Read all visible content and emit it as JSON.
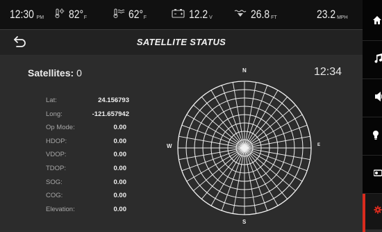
{
  "status_bar": {
    "time": {
      "value": "12:30",
      "unit": "PM",
      "icon": "clock"
    },
    "temp_1": {
      "value": "82°",
      "unit": "F",
      "icon": "thermometer-sun-icon"
    },
    "temp_2": {
      "value": "62°",
      "unit": "F",
      "icon": "thermometer-water-icon"
    },
    "voltage": {
      "value": "12.2",
      "unit": "V",
      "icon": "battery-icon"
    },
    "depth": {
      "value": "26.8",
      "unit": "FT",
      "icon": "depth-icon"
    },
    "speed": {
      "value": "23.2",
      "unit": "MPH"
    }
  },
  "header": {
    "title": "SATELLITE STATUS",
    "back_icon": "back-arrow-icon"
  },
  "satellites": {
    "label": "Satellites:",
    "count": "0"
  },
  "clock": "12:34",
  "gps_fields": [
    {
      "label": "Lat:",
      "value": "24.156793"
    },
    {
      "label": "Long:",
      "value": "-121.657942"
    },
    {
      "label": "Op Mode:",
      "value": "0.00"
    },
    {
      "label": "HDOP:",
      "value": "0.00"
    },
    {
      "label": "VDOP:",
      "value": "0.00"
    },
    {
      "label": "TDOP:",
      "value": "0.00"
    },
    {
      "label": "SOG:",
      "value": "0.00"
    },
    {
      "label": "COG:",
      "value": "0.00"
    },
    {
      "label": "Elevation:",
      "value": "0.00"
    }
  ],
  "polar_plot": {
    "north": "N",
    "south": "S",
    "east": "E",
    "west": "W"
  },
  "sidebar": {
    "items": [
      {
        "name": "home",
        "icon": "home-icon"
      },
      {
        "name": "music",
        "icon": "music-note-icon"
      },
      {
        "name": "volume",
        "icon": "speaker-icon"
      },
      {
        "name": "lights",
        "icon": "lightbulb-icon"
      },
      {
        "name": "toggle",
        "icon": "toggle-icon"
      },
      {
        "name": "settings",
        "icon": "gear-icon",
        "active": true
      }
    ]
  },
  "colors": {
    "accent": "#d92b1e",
    "background": "#2c2c2c",
    "status_bar": "#111111",
    "sidebar": "#050505"
  }
}
